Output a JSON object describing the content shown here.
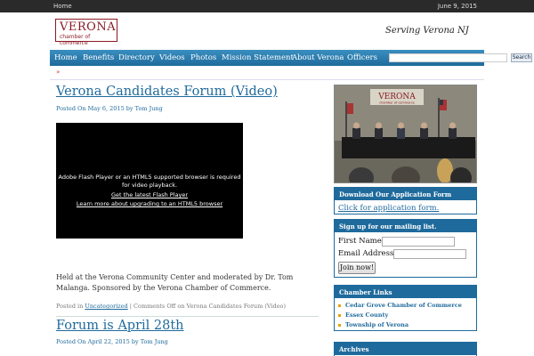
{
  "topbar": {
    "home_label": "Home",
    "date": "June 9, 2015"
  },
  "header": {
    "logo_name": "VERONA",
    "logo_sub": "chamber of commerce",
    "tagline": "Serving Verona NJ"
  },
  "nav": {
    "items": [
      "Home",
      "Benefits",
      "Directory",
      "Videos",
      "Photos",
      "Mission Statement",
      "About Verona",
      "Officers"
    ],
    "search_button": "Search",
    "search_value": ""
  },
  "breadcrumb": {
    "arrow": "»"
  },
  "posts": [
    {
      "title": "Verona Candidates Forum (Video)",
      "meta": "Posted On May 6, 2015 by Tom Jung",
      "video": {
        "message": "Adobe Flash Player or an HTML5 supported browser is required for video playback.",
        "link1": "Get the latest Flash Player",
        "link2": "Learn more about upgrading to an HTML5 browser"
      },
      "body": "Held at the Verona Community Center and moderated by Dr. Tom Malanga. Sponsored by the Verona Chamber of Commerce.",
      "foot_prefix": "Posted in ",
      "foot_category": "Uncategorized",
      "foot_suffix": " | Comments Off on Verona Candidates Forum (Video)"
    },
    {
      "title": "Forum is April 28th",
      "meta": "Posted On April 22, 2015 by Tom Jung"
    }
  ],
  "sidebar": {
    "photo_banner": "VERONA",
    "photo_banner_sub": "chamber of commerce",
    "download": {
      "title": "Download Our Application Form",
      "link": "Click for application form."
    },
    "mailing": {
      "title": "Sign up for our mailing list.",
      "first_name_label": "First Name :",
      "email_label": "Email Address :",
      "join_button": "Join now!"
    },
    "chamber_links": {
      "title": "Chamber Links",
      "items": [
        "Cedar Grove Chamber of Commerce",
        "Essex County",
        "Township of Verona"
      ]
    },
    "archives": {
      "title": "Archives"
    }
  }
}
